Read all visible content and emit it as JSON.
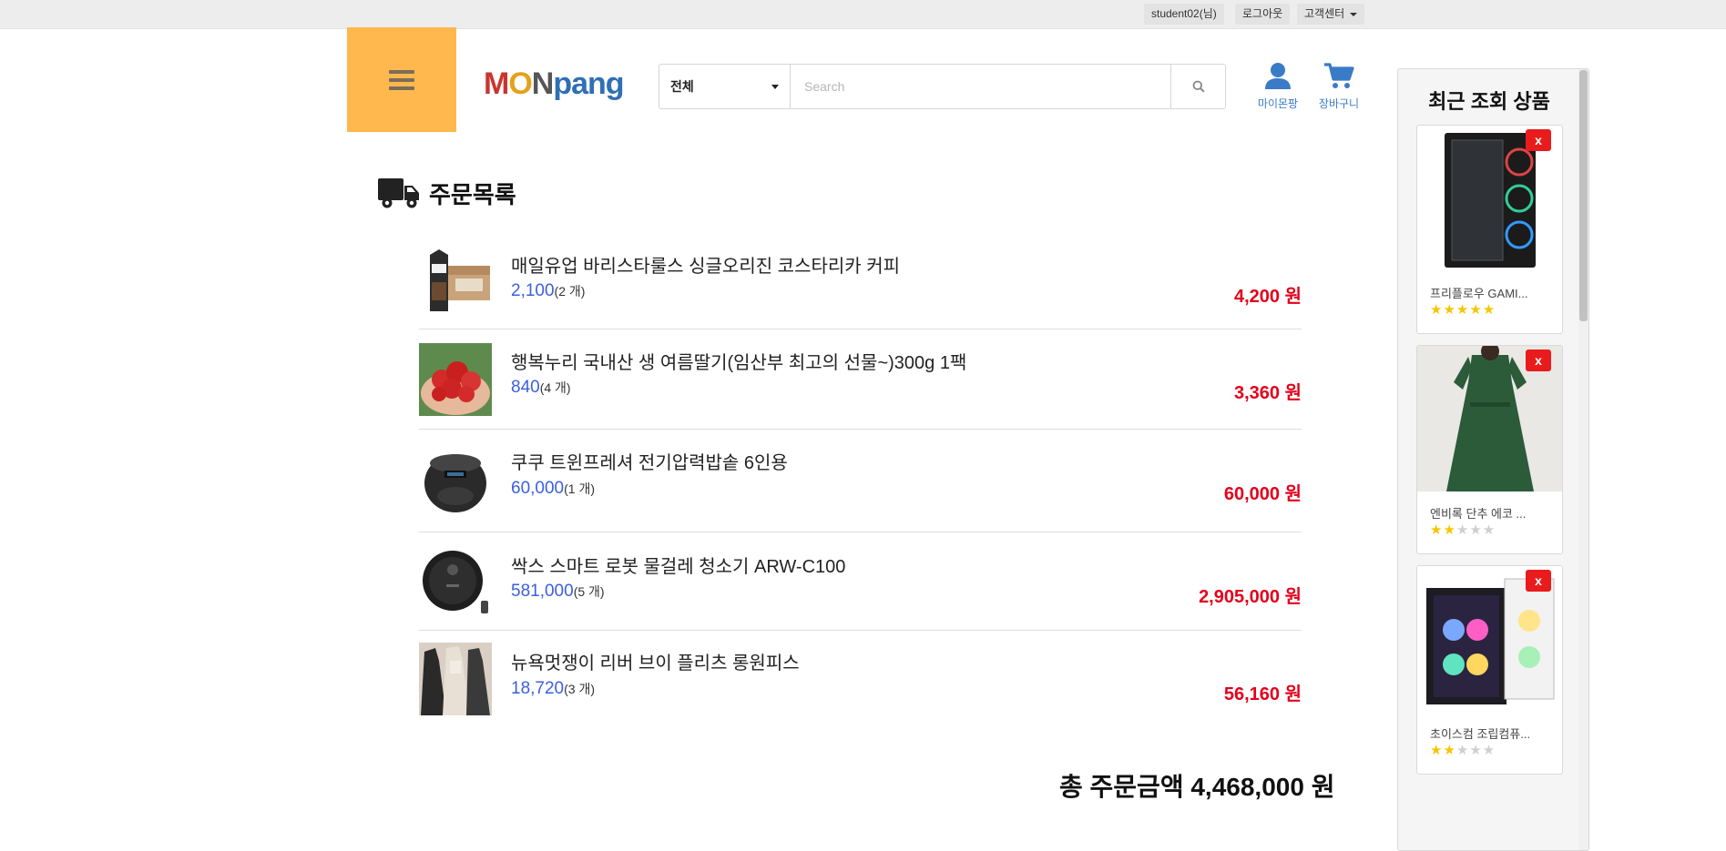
{
  "topbar": {
    "user": "student02(님)",
    "logout": "로그아웃",
    "customer_center": "고객센터"
  },
  "header": {
    "logo": {
      "part1": "M",
      "part2": "O",
      "part3": "N",
      "part4": "pang"
    },
    "search": {
      "category": "전체",
      "placeholder": "Search"
    },
    "my_label": "마이몬팡",
    "cart_label": "장바구니"
  },
  "orders": {
    "title": "주문목록",
    "items": [
      {
        "name": "매일유업 바리스타룰스 싱글오리진 코스타리카 커피",
        "price": "2,100",
        "qty": "(2 개)",
        "total": "4,200 원"
      },
      {
        "name": "행복누리 국내산 생 여름딸기(임산부 최고의 선물~)300g 1팩",
        "price": "840",
        "qty": "(4 개)",
        "total": "3,360 원"
      },
      {
        "name": "쿠쿠 트윈프레셔 전기압력밥솥 6인용",
        "price": "60,000",
        "qty": "(1 개)",
        "total": "60,000 원"
      },
      {
        "name": "싹스 스마트 로봇 물걸레 청소기 ARW-C100",
        "price": "581,000",
        "qty": "(5 개)",
        "total": "2,905,000 원"
      },
      {
        "name": "뉴욕멋쟁이 리버 브이 플리츠 롱원피스",
        "price": "18,720",
        "qty": "(3 개)",
        "total": "56,160 원"
      }
    ],
    "grand_total": "총 주문금액 4,468,000 원"
  },
  "recent": {
    "title": "최근 조회 상품",
    "items": [
      {
        "name": "프리플로우 GAMI...",
        "rating": 5,
        "close": "x"
      },
      {
        "name": "엔비록 단추 에코 ...",
        "rating": 2,
        "close": "x"
      },
      {
        "name": "초이스컴 조립컴퓨...",
        "rating": 2,
        "close": "x"
      }
    ]
  },
  "colors": {
    "accent": "#ffb84d",
    "link_blue": "#3a7bc8",
    "price_blue": "#3b5fe0",
    "total_red": "#e3001b",
    "close_red": "#e81c1c"
  }
}
